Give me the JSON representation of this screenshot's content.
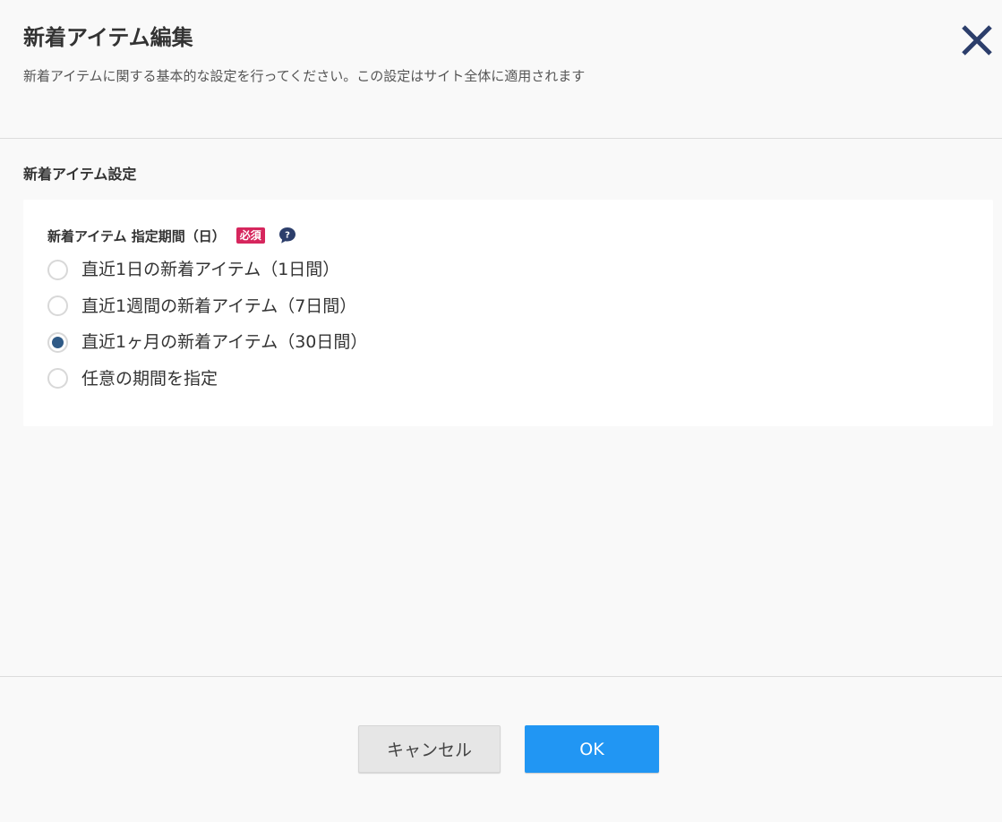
{
  "header": {
    "title": "新着アイテム編集",
    "subtitle": "新着アイテムに関する基本的な設定を行ってください。この設定はサイト全体に適用されます"
  },
  "section": {
    "title": "新着アイテム設定"
  },
  "field": {
    "label": "新着アイテム 指定期間（日）",
    "required_label": "必須",
    "options": [
      {
        "label": "直近1日の新着アイテム（1日間）",
        "checked": false
      },
      {
        "label": "直近1週間の新着アイテム（7日間）",
        "checked": false
      },
      {
        "label": "直近1ヶ月の新着アイテム（30日間）",
        "checked": true
      },
      {
        "label": "任意の期間を指定",
        "checked": false
      }
    ]
  },
  "footer": {
    "cancel_label": "キャンセル",
    "ok_label": "OK"
  },
  "colors": {
    "accent": "#2196f3",
    "required": "#d6265d",
    "radio_checked": "#2f5a86",
    "close_icon": "#2c3e6b"
  },
  "icons": {
    "close": "close-icon",
    "help": "question-bubble-icon"
  }
}
